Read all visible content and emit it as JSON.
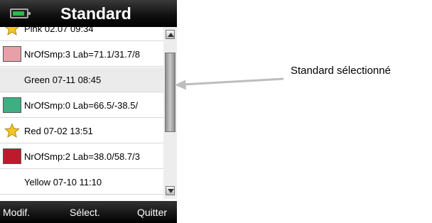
{
  "header": {
    "title": "Standard",
    "battery_color": "#2fb84a"
  },
  "list": [
    {
      "icon": "star",
      "text": "Pink 02.07 09:34"
    },
    {
      "swatch": "#e8a0a8",
      "text": "NrOfSmp:3 Lab=71.1/31.7/8"
    },
    {
      "icon": "none",
      "text": "Green 07-11 08:45",
      "selected": true
    },
    {
      "swatch": "#3fae82",
      "text": "NrOfSmp:0 Lab=66.5/-38.5/"
    },
    {
      "icon": "star",
      "text": "Red 07-02 13:51"
    },
    {
      "swatch": "#bf1a2c",
      "text": "NrOfSmp:2 Lab=38.0/58.7/3"
    },
    {
      "icon": "none",
      "text": "Yellow 07-10 11:10"
    }
  ],
  "softkeys": {
    "left": "Modif.",
    "center": "Sélect.",
    "right": "Quitter"
  },
  "annotation": {
    "text": "Standard sélectionné"
  }
}
